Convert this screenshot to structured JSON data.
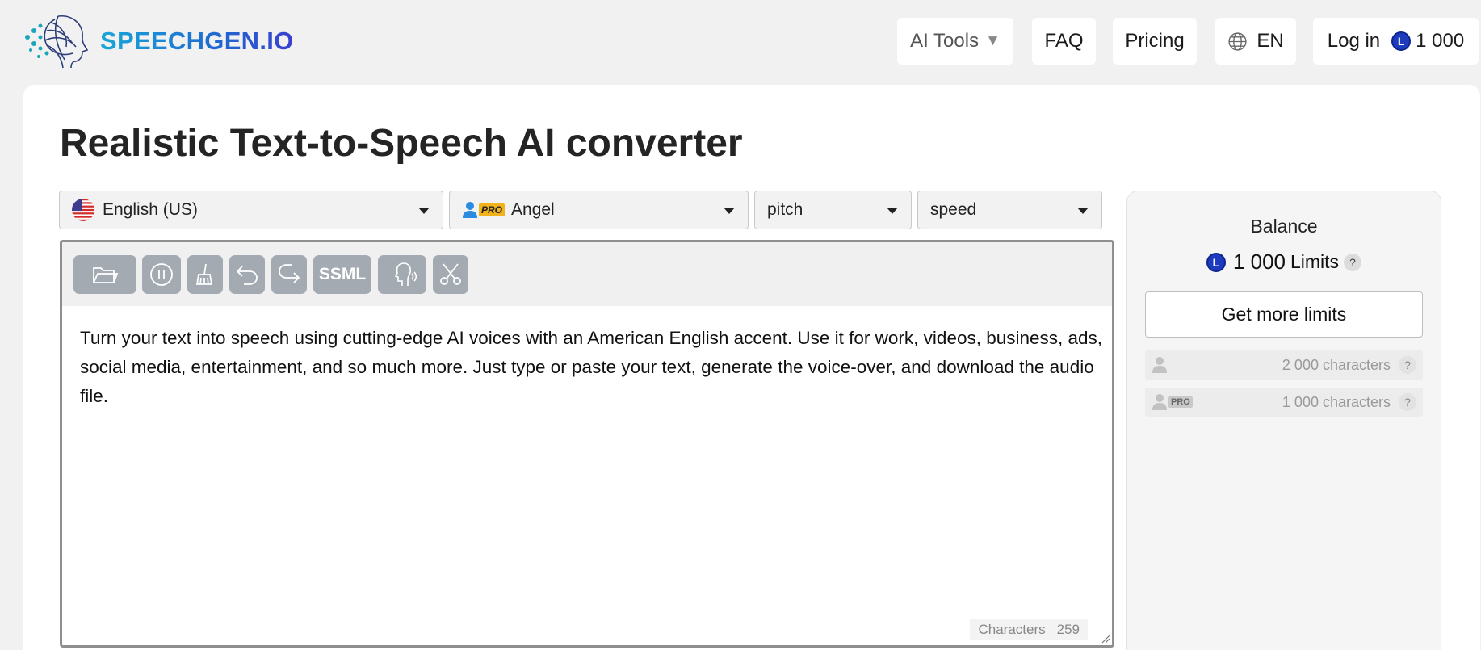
{
  "header": {
    "logo_text": "SPEECHGEN.IO",
    "nav": {
      "ai_tools": "AI Tools",
      "ai_tools_caret": "▼",
      "faq": "FAQ",
      "pricing": "Pricing",
      "lang": "EN",
      "login": "Log in",
      "coin_letter": "L",
      "balance": "1 000"
    }
  },
  "page": {
    "title": "Realistic Text-to-Speech AI converter"
  },
  "controls": {
    "language": "English (US)",
    "voice_badge": "PRO",
    "voice": "Angel",
    "pitch": "pitch",
    "speed": "speed"
  },
  "toolbar": {
    "buttons": [
      "open-file",
      "pause",
      "clear",
      "undo",
      "redo",
      "SSML",
      "voice",
      "cut"
    ],
    "ssml_label": "SSML"
  },
  "editor": {
    "text": "Turn your text into speech using cutting-edge AI voices with an American English accent. Use it for work, videos, business, ads, social media, entertainment, and so much more. Just type or paste your text, generate the voice-over, and download the audio file.",
    "count_label": "Characters",
    "count_value": "259"
  },
  "balance": {
    "title": "Balance",
    "coin_letter": "L",
    "amount": "1 000",
    "unit": "Limits",
    "help": "?",
    "more_button": "Get more limits",
    "limits": [
      {
        "badge": "",
        "text": "2 000 characters",
        "help": "?"
      },
      {
        "badge": "PRO",
        "text": "1 000 characters",
        "help": "?"
      }
    ]
  },
  "colors": {
    "accent_blue": "#1c3bbd",
    "toolbar_button": "#a3aab1",
    "pro_badge": "#f2b21b"
  }
}
